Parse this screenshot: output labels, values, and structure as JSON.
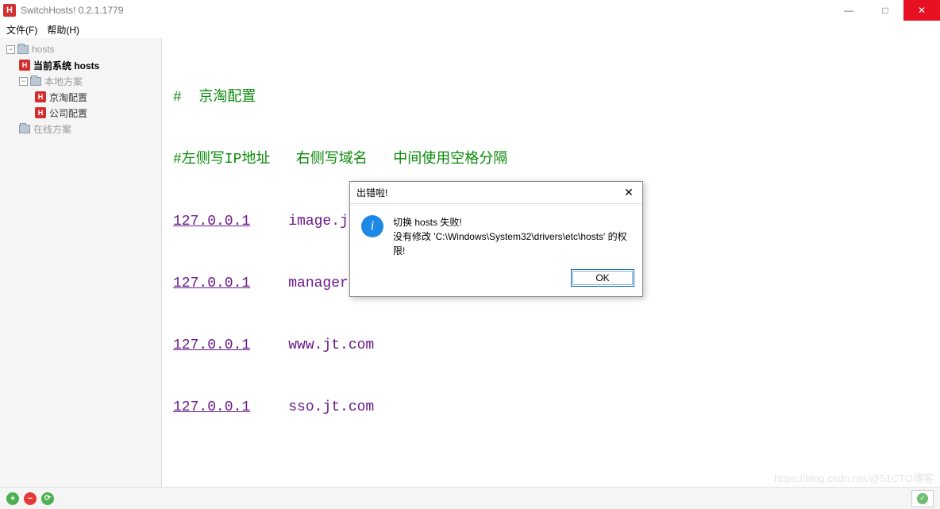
{
  "titlebar": {
    "icon_letter": "H",
    "title": "SwitchHosts! 0.2.1.1779",
    "minimize": "—",
    "maximize": "□",
    "close": "✕"
  },
  "menubar": {
    "file": "文件(F)",
    "help": "帮助(H)"
  },
  "tree": {
    "expand_minus": "−",
    "root": "hosts",
    "current": "当前系统 hosts",
    "local_group": "本地方案",
    "item_jingtao": "京淘配置",
    "item_company": "公司配置",
    "online_group": "在线方案",
    "h_icon": "H"
  },
  "editor": {
    "comment1": "#  京淘配置",
    "comment2": "#左侧写IP地址   右侧写域名   中间使用空格分隔",
    "lines": [
      {
        "ip": "127.0.0.1",
        "domain": "image.jt.com"
      },
      {
        "ip": "127.0.0.1",
        "domain": "manager.jt.com"
      },
      {
        "ip": "127.0.0.1",
        "domain": "www.jt.com"
      },
      {
        "ip": "127.0.0.1",
        "domain": "sso.jt.com"
      }
    ]
  },
  "footer": {
    "add": "+",
    "del": "−",
    "refresh": "⟳",
    "status_check": "✓"
  },
  "watermark": "https://blog.csdn.net/@51CTO博客",
  "modal": {
    "title": "出错啦!",
    "close": "✕",
    "icon": "i",
    "line1": "切换 hosts 失败!",
    "line2": "没有修改 'C:\\Windows\\System32\\drivers\\etc\\hosts' 的权限!",
    "ok": "OK"
  }
}
